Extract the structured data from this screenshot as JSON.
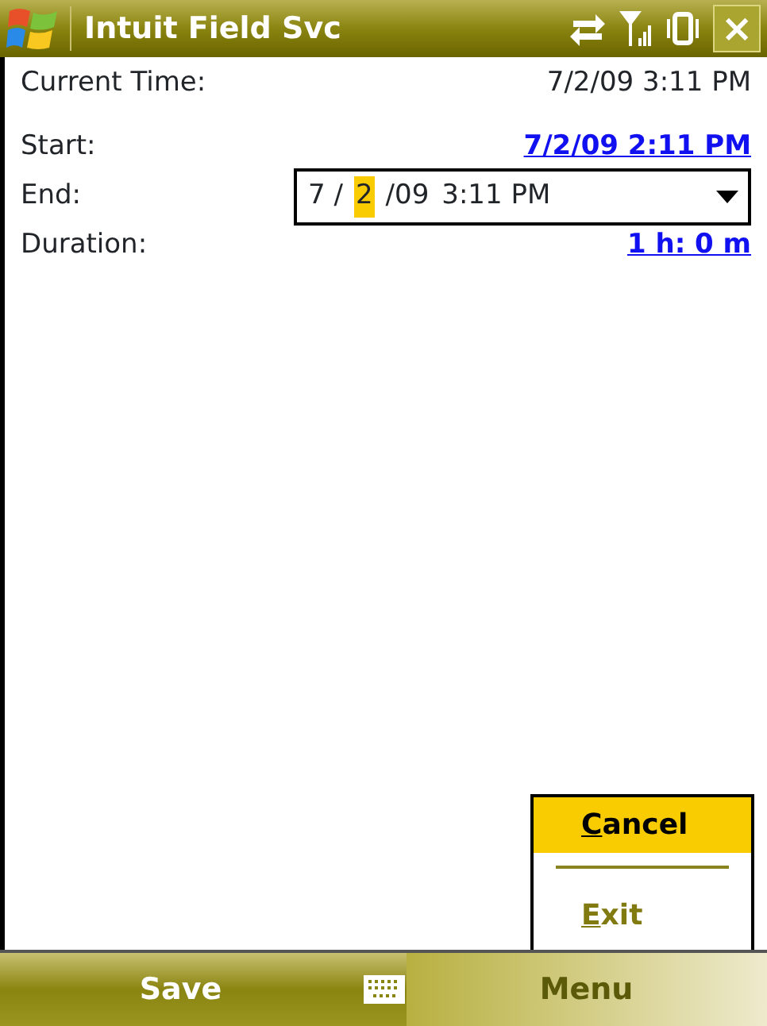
{
  "title_bar": {
    "title": "Intuit Field Svc",
    "close": "×"
  },
  "fields": [
    {
      "kind": "text",
      "label": "Current Time:",
      "value": "7/2/09 3:11 PM"
    },
    {
      "kind": "link",
      "label": "Start:",
      "value": "7/2/09 2:11 PM"
    },
    {
      "kind": "picker",
      "label": "End:",
      "segments": [
        {
          "text": "7 /",
          "selected": false
        },
        {
          "text": "2",
          "selected": true
        },
        {
          "text": "/09",
          "selected": false
        },
        {
          "text": "3:11 PM",
          "selected": false
        }
      ]
    },
    {
      "kind": "link",
      "label": "Duration:",
      "value": "1 h: 0 m"
    }
  ],
  "menu": [
    {
      "label": "Cancel",
      "selected": true
    },
    {
      "label": "Exit",
      "selected": false
    }
  ],
  "soft_keys": [
    {
      "label": "Save",
      "active": false
    },
    {
      "label": "Menu",
      "active": true
    }
  ]
}
